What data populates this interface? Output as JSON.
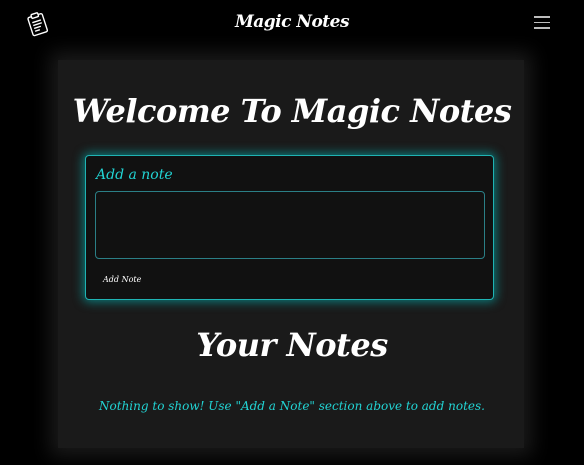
{
  "navbar": {
    "logo_icon": "clipboard-notes-icon",
    "title": "Magic Notes",
    "menu_icon": "hamburger-menu-icon"
  },
  "main": {
    "welcome_title": "Welcome To Magic Notes",
    "add_note": {
      "label": "Add a note",
      "textarea_value": "",
      "button_label": "Add Note"
    },
    "your_notes_title": "Your Notes",
    "empty_message": "Nothing to show! Use \"Add a Note\" section above to add notes."
  },
  "colors": {
    "background": "#000000",
    "panel": "#1a1a1a",
    "accent": "#22d3d3",
    "text": "#ffffff"
  }
}
